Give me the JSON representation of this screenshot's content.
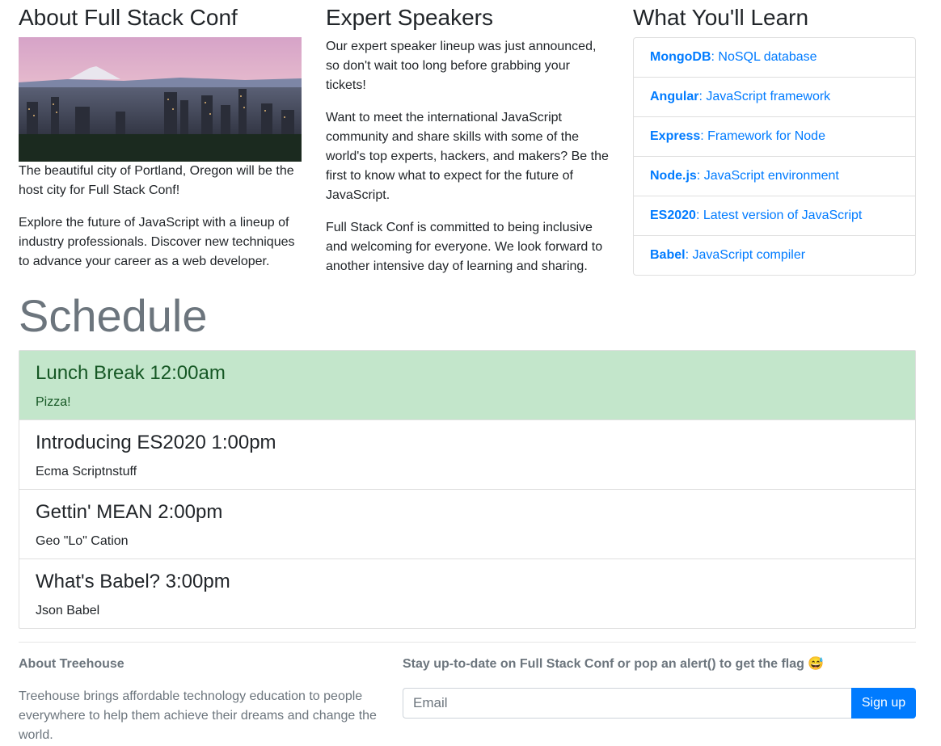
{
  "about": {
    "heading": "About Full Stack Conf",
    "paragraphs": [
      "The beautiful city of Portland, Oregon will be the host city for Full Stack Conf!",
      "Explore the future of JavaScript with a lineup of industry professionals. Discover new techniques to advance your career as a web developer."
    ]
  },
  "speakers": {
    "heading": "Expert Speakers",
    "paragraphs": [
      "Our expert speaker lineup was just announced, so don't wait too long before grabbing your tickets!",
      "Want to meet the international JavaScript community and share skills with some of the world's top experts, hackers, and makers? Be the first to know what to expect for the future of JavaScript.",
      "Full Stack Conf is committed to being inclusive and welcoming for everyone. We look forward to another intensive day of learning and sharing."
    ]
  },
  "learn": {
    "heading": "What You'll Learn",
    "items": [
      {
        "tech": "MongoDB",
        "desc": ": NoSQL database"
      },
      {
        "tech": "Angular",
        "desc": ": JavaScript framework"
      },
      {
        "tech": "Express",
        "desc": ": Framework for Node"
      },
      {
        "tech": "Node.js",
        "desc": ": JavaScript environment"
      },
      {
        "tech": "ES2020",
        "desc": ": Latest version of JavaScript"
      },
      {
        "tech": "Babel",
        "desc": ": JavaScript compiler"
      }
    ]
  },
  "schedule": {
    "heading": "Schedule",
    "sessions": [
      {
        "title": "Lunch Break 12:00am",
        "speaker": "Pizza!"
      },
      {
        "title": "Introducing ES2020 1:00pm",
        "speaker": "Ecma Scriptnstuff"
      },
      {
        "title": "Gettin' MEAN 2:00pm",
        "speaker": "Geo \"Lo\" Cation"
      },
      {
        "title": "What's Babel? 3:00pm",
        "speaker": "Json Babel"
      }
    ]
  },
  "footer": {
    "about_heading": "About Treehouse",
    "about_text": "Treehouse brings affordable technology education to people everywhere to help them achieve their dreams and change the world.",
    "signup_heading": "Stay up-to-date on Full Stack Conf or pop an alert() to get the flag 😅",
    "email_placeholder": "Email",
    "signup_button": "Sign up"
  },
  "colors": {
    "link": "#007bff",
    "highlight_bg": "#c3e6cb",
    "highlight_text": "#155724",
    "muted": "#6c757d"
  }
}
